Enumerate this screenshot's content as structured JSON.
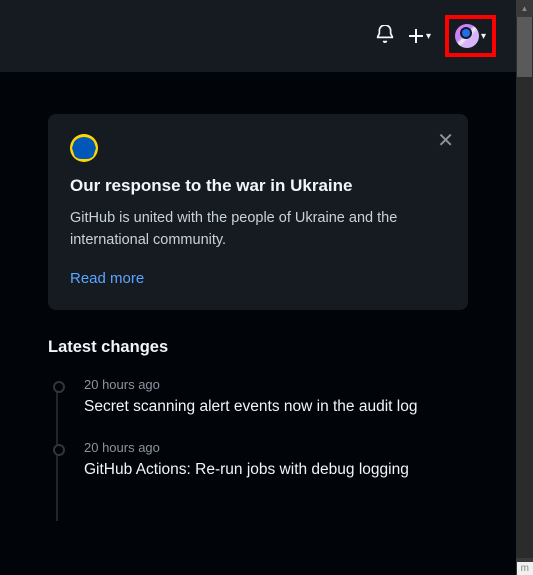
{
  "topbar": {
    "bell": "bell-icon",
    "plus": "plus-icon",
    "avatar": "user-avatar",
    "caret": "▾"
  },
  "banner": {
    "logo_alt": "github-ukraine-logo",
    "close": "✕",
    "title": "Our response to the war in Ukraine",
    "body": "GitHub is united with the people of Ukraine and the international community.",
    "link": "Read more"
  },
  "changes": {
    "heading": "Latest changes",
    "items": [
      {
        "time": "20 hours ago",
        "title": "Secret scanning alert events now in the audit log"
      },
      {
        "time": "20 hours ago",
        "title": "GitHub Actions: Re-run jobs with debug logging"
      }
    ]
  },
  "overlay_fragment": "m"
}
